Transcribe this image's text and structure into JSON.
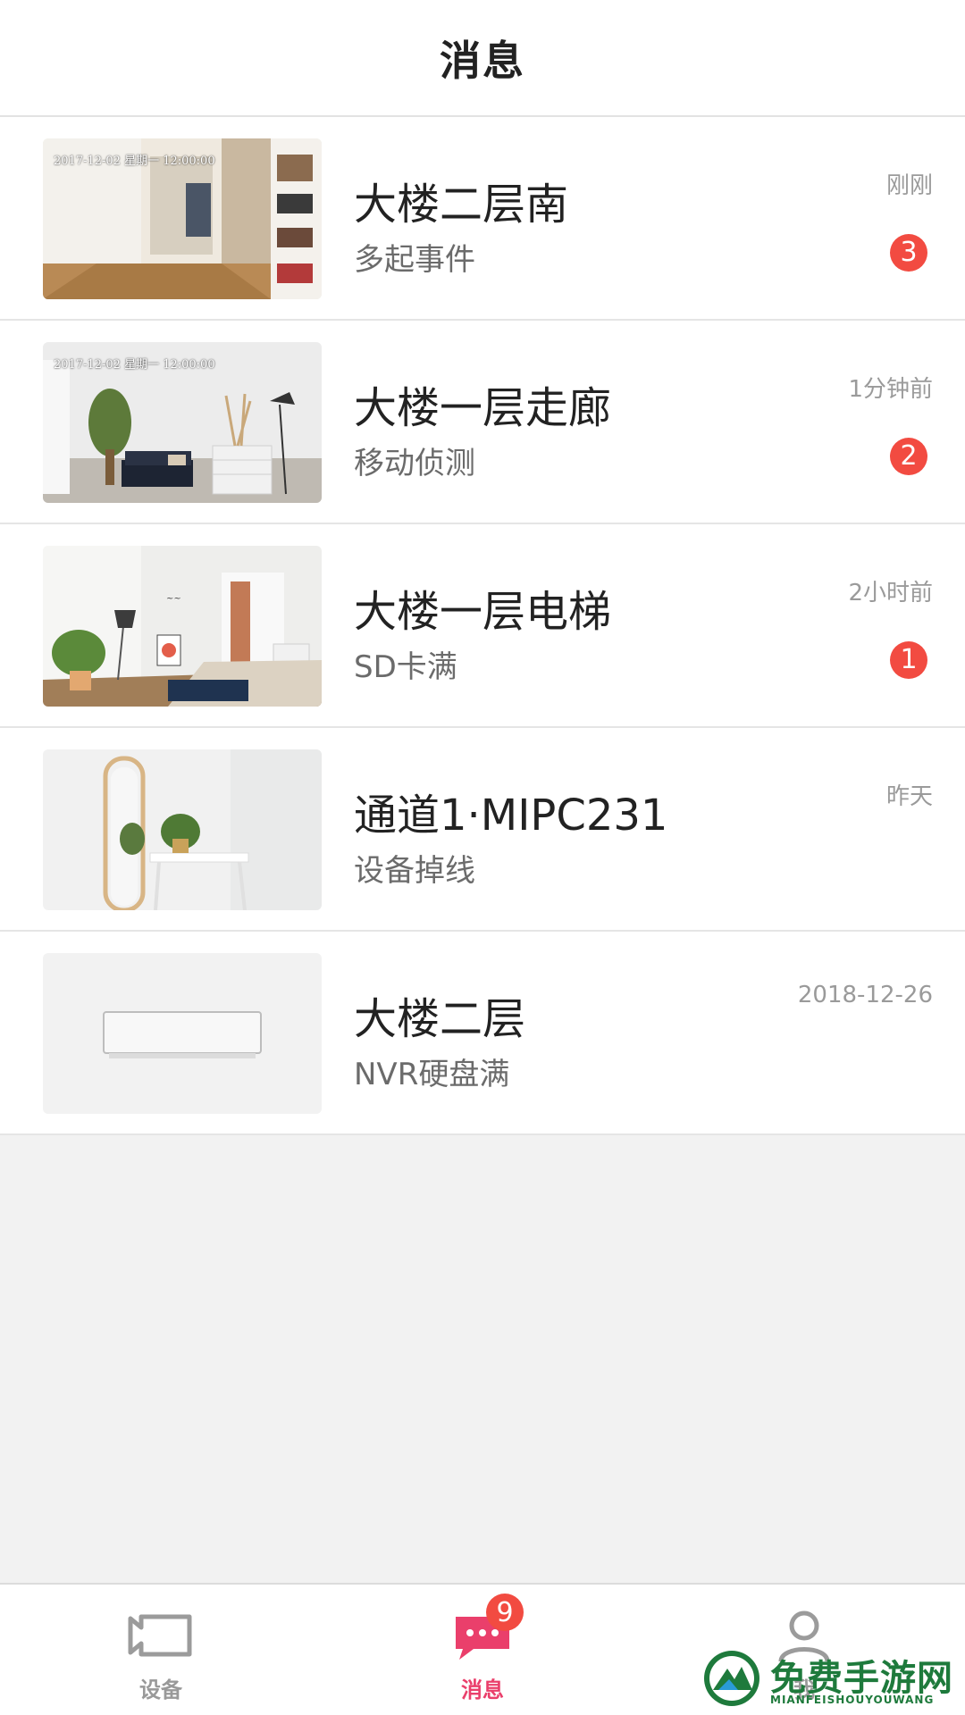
{
  "header": {
    "title": "消息"
  },
  "messages": [
    {
      "device": "大楼二层南",
      "event": "多起事件",
      "time": "刚刚",
      "badge": "3",
      "osd": "2017-12-02 星期一 12:00:00",
      "thumb": "living-room-hallway"
    },
    {
      "device": "大楼一层走廊",
      "event": "移动侦测",
      "time": "1分钟前",
      "badge": "2",
      "osd": "2017-12-02 星期一 12:00:00",
      "thumb": "living-room-sofa"
    },
    {
      "device": "大楼一层电梯",
      "event": "SD卡满",
      "time": "2小时前",
      "badge": "1",
      "osd": "",
      "thumb": "bedroom"
    },
    {
      "device": "通道1·MIPC231",
      "event": "设备掉线",
      "time": "昨天",
      "badge": "",
      "osd": "",
      "thumb": "mirror-table"
    },
    {
      "device": "大楼二层",
      "event": "NVR硬盘满",
      "time": "2018-12-26",
      "badge": "",
      "osd": "",
      "thumb": "nvr-device"
    }
  ],
  "tabbar": {
    "items": [
      {
        "label": "设备",
        "icon": "camera-icon",
        "active": false
      },
      {
        "label": "消息",
        "icon": "message-icon",
        "active": true,
        "badge": "9"
      },
      {
        "label": "我",
        "icon": "person-icon",
        "active": false
      }
    ]
  },
  "watermark": {
    "text": "免费手游网",
    "sub": "MIANFEISHOUYOUWANG"
  },
  "colors": {
    "accent": "#ea3f6b",
    "badge": "#f24b41",
    "watermark": "#1e7a3c"
  }
}
